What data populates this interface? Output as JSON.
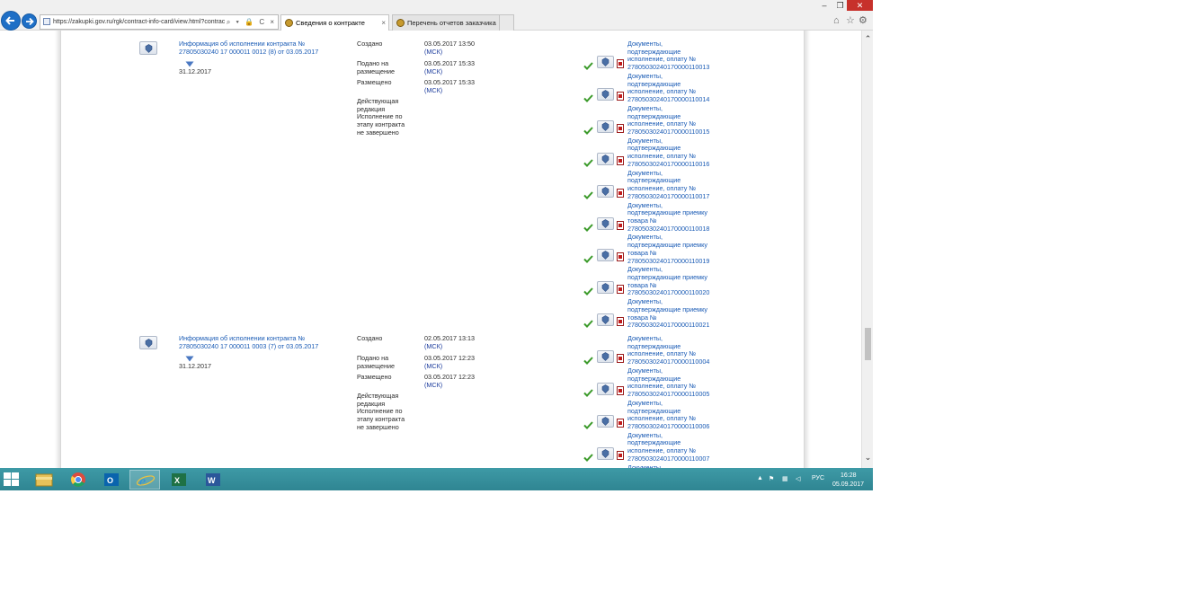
{
  "browser": {
    "url": "https://zakupki.gov.ru/rgk/contract-info-card/view.html?contrac",
    "tabs": [
      {
        "label": "Сведения о контракте",
        "close": "×"
      },
      {
        "label": "Перечень отчетов заказчика"
      }
    ],
    "window_controls": {
      "minimize": "–",
      "restore": "❐",
      "close": "✕"
    },
    "toolbar_icons": [
      "home-icon",
      "star-icon",
      "gear-icon"
    ],
    "address_tools": "⌕ ▾ 🔒 C ×"
  },
  "records": [
    {
      "title": "Информация об исполнении контракта № 27805030240 17 000011 0012 (8) от 03.05.2017",
      "date": "31.12.2017",
      "events": [
        {
          "label": "Создано",
          "date": "03.05.2017 13:50",
          "tz": "(МСК)"
        },
        {
          "label": "Подано на размещение",
          "date": "03.05.2017 15:33",
          "tz": "(МСК)"
        },
        {
          "label": "Размещено",
          "date": "03.05.2017 15:33",
          "tz": "(МСК)"
        }
      ],
      "status": "Действующая редакция Исполнение по этапу контракта не завершено",
      "documents": [
        "Документы, подтверждающие исполнение, оплату № 27805030240170000110013",
        "Документы, подтверждающие исполнение, оплату № 27805030240170000110014",
        "Документы, подтверждающие исполнение, оплату № 27805030240170000110015",
        "Документы, подтверждающие исполнение, оплату № 27805030240170000110016",
        "Документы, подтверждающие исполнение, оплату № 27805030240170000110017",
        "Документы, подтверждающие приемку товара № 27805030240170000110018",
        "Документы, подтверждающие приемку товара № 27805030240170000110019",
        "Документы, подтверждающие приемку товара № 27805030240170000110020",
        "Документы, подтверждающие приемку товара № 27805030240170000110021"
      ]
    },
    {
      "title": "Информация об исполнении контракта № 27805030240 17 000011 0003 (7) от 03.05.2017",
      "date": "31.12.2017",
      "events": [
        {
          "label": "Создано",
          "date": "02.05.2017 13:13",
          "tz": "(МСК)"
        },
        {
          "label": "Подано на размещение",
          "date": "03.05.2017 12:23",
          "tz": "(МСК)"
        },
        {
          "label": "Размещено",
          "date": "03.05.2017 12:23",
          "tz": "(МСК)"
        }
      ],
      "status": "Действующая редакция Исполнение по этапу контракта не завершено",
      "documents": [
        "Документы, подтверждающие исполнение, оплату № 27805030240170000110004",
        "Документы, подтверждающие исполнение, оплату № 27805030240170000110005",
        "Документы, подтверждающие исполнение, оплату № 27805030240170000110006",
        "Документы, подтверждающие исполнение, оплату № 27805030240170000110007",
        "Документы,"
      ]
    }
  ],
  "taskbar": {
    "apps": [
      "file-explorer-icon",
      "chrome-icon",
      "outlook-icon",
      "internet-explorer-icon",
      "excel-icon",
      "word-icon"
    ],
    "tray": {
      "arrow": "▲",
      "lang": "РУС"
    },
    "clock": {
      "time": "16:28",
      "date": "05.09.2017"
    }
  },
  "colors": {
    "link": "#1a5bb5",
    "taskbar": "#3a93a0",
    "check": "#3b9a2a",
    "close": "#c7312b"
  }
}
